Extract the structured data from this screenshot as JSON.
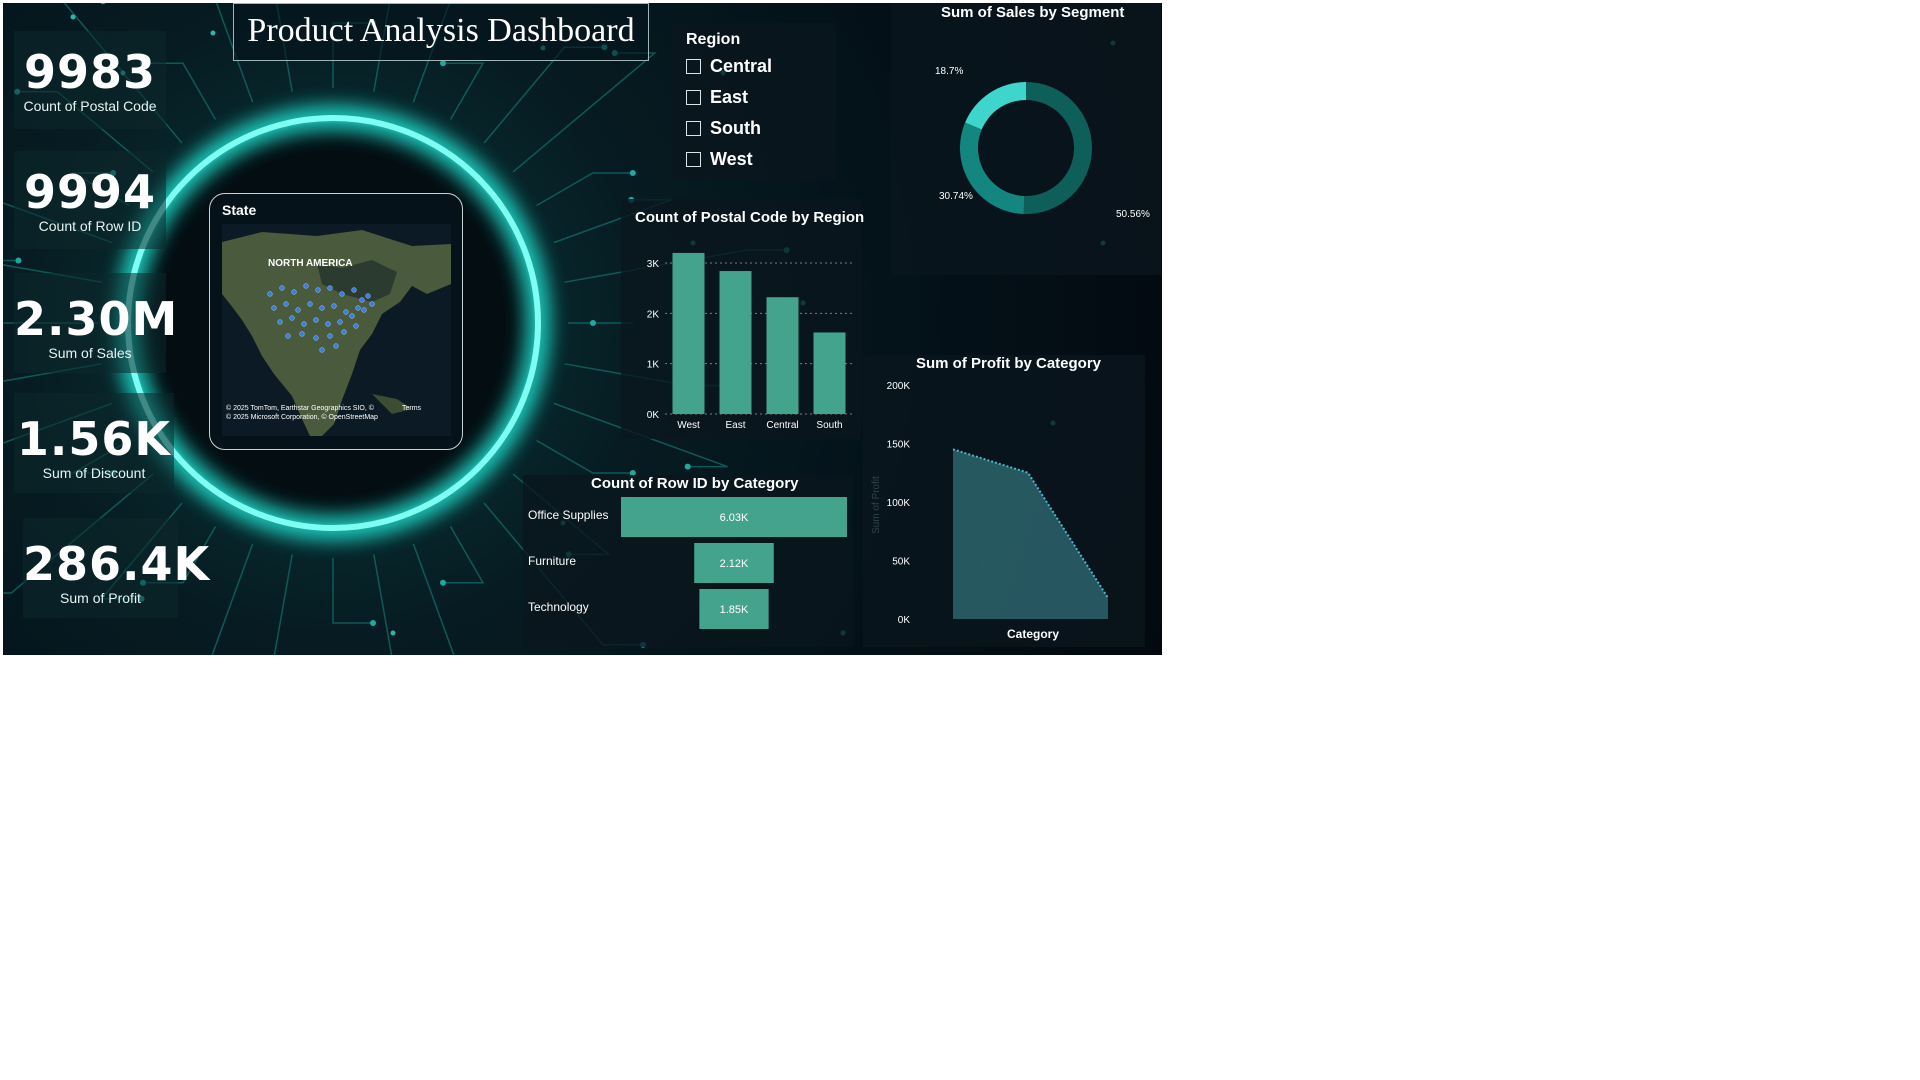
{
  "title": "Product Analysis Dashboard",
  "kpis": [
    {
      "value": "9983",
      "label": "Count of Postal Code"
    },
    {
      "value": "9994",
      "label": "Count of Row ID"
    },
    {
      "value": "2.30M",
      "label": "Sum of Sales"
    },
    {
      "value": "1.56K",
      "label": "Sum of Discount"
    },
    {
      "value": "286.4K",
      "label": "Sum of Profit"
    }
  ],
  "region_slicer": {
    "title": "Region",
    "options": [
      "Central",
      "East",
      "South",
      "West"
    ]
  },
  "map": {
    "title": "State",
    "continent_label": "NORTH AMERICA",
    "attribution_1": "© 2025 TomTom, Earthstar Geographics SIO, ©",
    "attribution_terms": "Terms",
    "attribution_2": "© 2025 Microsoft Corporation, © OpenStreetMap",
    "colors": {
      "land": "#4a5a3c",
      "sea": "#0b1a24",
      "dots": "#3a7ee0"
    }
  },
  "colors": {
    "accent": "#44a38c",
    "donut": [
      "#0e5e5a",
      "#138680",
      "#3ed6cc"
    ],
    "area_fill": "#2a5f68",
    "area_line": "#49b7cf",
    "glow": "#20f5e2"
  },
  "chart_data": [
    {
      "id": "postal-by-region",
      "type": "bar",
      "title": "Count of Postal Code by Region",
      "categories": [
        "West",
        "East",
        "Central",
        "South"
      ],
      "values": [
        3200,
        2840,
        2320,
        1620
      ],
      "ylim": [
        0,
        3000
      ],
      "yticks": [
        0,
        1000,
        2000,
        3000
      ],
      "ytick_labels": [
        "0K",
        "1K",
        "2K",
        "3K"
      ],
      "grid": true
    },
    {
      "id": "sales-by-segment",
      "type": "pie",
      "title": "Sum of Sales by Segment",
      "slices": [
        50.56,
        30.74,
        18.7
      ],
      "labels": [
        "50.56%",
        "30.74%",
        "18.7%"
      ]
    },
    {
      "id": "profit-by-category",
      "type": "area",
      "title": "Sum of Profit by Category",
      "xlabel": "Category",
      "ylabel": "Sum of Profit",
      "points": [
        145000,
        125000,
        18000
      ],
      "ylim": [
        0,
        200000
      ],
      "yticks": [
        0,
        50000,
        100000,
        150000,
        200000
      ],
      "ytick_labels": [
        "0K",
        "50K",
        "100K",
        "150K",
        "200K"
      ]
    },
    {
      "id": "rows-by-category",
      "type": "bar",
      "orientation": "horizontal-funnel",
      "title": "Count of Row ID by Category",
      "categories": [
        "Office Supplies",
        "Furniture",
        "Technology"
      ],
      "values": [
        6026,
        2121,
        1847
      ],
      "value_labels": [
        "6.03K",
        "2.12K",
        "1.85K"
      ]
    }
  ]
}
